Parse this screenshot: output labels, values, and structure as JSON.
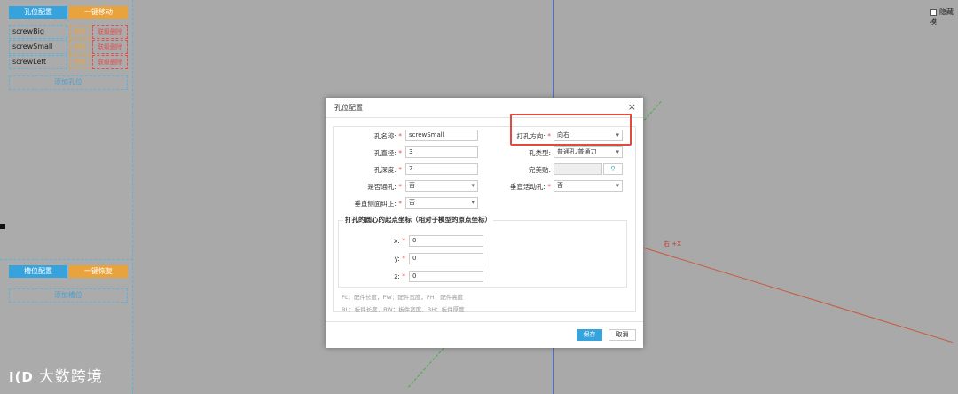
{
  "left_panel": {
    "hole_config_btn": "孔位配置",
    "one_click_move_btn": "一键移动",
    "holes": [
      {
        "name": "screwBig",
        "delete": "删除",
        "linked_delete": "联级删除"
      },
      {
        "name": "screwSmall",
        "delete": "删除",
        "linked_delete": "联级删除"
      },
      {
        "name": "screwLeft",
        "delete": "删除",
        "linked_delete": "联级删除"
      }
    ],
    "add_hole": "添加孔位",
    "slot_config_btn": "槽位配置",
    "one_click_restore_btn": "一键恢复",
    "add_slot": "添加槽位"
  },
  "scene": {
    "axis_label": "右 +X",
    "hide_checkbox_label": "隐藏模"
  },
  "dialog": {
    "title": "孔位配置",
    "close": "×",
    "fields": {
      "hole_name": {
        "label": "孔名称:",
        "value": "screwSmall"
      },
      "hole_diameter": {
        "label": "孔直径:",
        "value": "3"
      },
      "hole_depth": {
        "label": "孔深度:",
        "value": "7"
      },
      "is_through": {
        "label": "是否通孔:",
        "value": "否"
      },
      "vertical_correction": {
        "label": "垂直侧面纠正:",
        "value": "否"
      },
      "drill_direction": {
        "label": "打孔方向:",
        "value": "向右"
      },
      "hole_type": {
        "label": "孔类型:",
        "value": "普通孔/普通刀"
      },
      "finished_hole": {
        "label": "完美贴:",
        "value": ""
      },
      "vertical_adjust_hole": {
        "label": "垂直活动孔:",
        "value": "否"
      }
    },
    "coords_section": {
      "title": "打孔的圆心的起点坐标（相对于模型的原点坐标）",
      "x": {
        "label": "x:",
        "value": "0"
      },
      "y": {
        "label": "y:",
        "value": "0"
      },
      "z": {
        "label": "z:",
        "value": "0"
      }
    },
    "notes": [
      "PL：配件长度，PW：配件宽度，PH：配件高度",
      "BL：板件长度，BW：板件宽度，BH：板件厚度"
    ],
    "save": "保存",
    "cancel": "取消",
    "required_mark": "*"
  },
  "watermark": {
    "logo": "I(D",
    "text": "大数跨境"
  },
  "colors": {
    "accent_blue": "#37a3dc",
    "accent_orange": "#e8a33d",
    "highlight_red": "#e24a3b"
  }
}
